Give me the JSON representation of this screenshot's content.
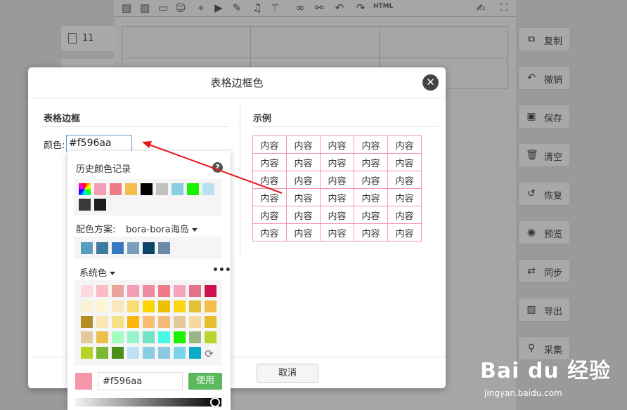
{
  "background": {
    "tab_label": "11",
    "toolbar_html_label": "HTML"
  },
  "side_buttons": [
    {
      "label": "复制",
      "icon": "copy-icon"
    },
    {
      "label": "撤销",
      "icon": "undo-icon"
    },
    {
      "label": "保存",
      "icon": "save-icon"
    },
    {
      "label": "清空",
      "icon": "trash-icon"
    },
    {
      "label": "恢复",
      "icon": "restore-icon"
    },
    {
      "label": "预览",
      "icon": "eye-icon"
    },
    {
      "label": "同步",
      "icon": "sync-icon"
    },
    {
      "label": "导出",
      "icon": "export-icon"
    },
    {
      "label": "采集",
      "icon": "search-icon"
    }
  ],
  "dialog": {
    "title": "表格边框色",
    "border_section_title": "表格边框",
    "color_label": "颜色:",
    "color_value": "#f596aa",
    "example_section_title": "示例",
    "example_cell_text": "内容",
    "cancel_label": "取消"
  },
  "picker": {
    "history_label": "历史颜色记录",
    "scheme_label": "配色方案:",
    "scheme_name": "bora-bora海岛",
    "system_label": "系统色",
    "hex_value": "#f596aa",
    "use_label": "使用",
    "current_color": "#f596aa",
    "history_colors": [
      "rainbow",
      "#f39cb4",
      "#ee7a86",
      "#f3bf4a",
      "#000000",
      "#c0c0c0",
      "#87cde4",
      "#19f201",
      "#b9e2ef",
      "#3a3a3a",
      "#1e1e1e"
    ],
    "scheme_colors": [
      "#5b9dc0",
      "#3f7aa0",
      "#3779c1",
      "#7b9dbd",
      "#0b4466",
      "#6a88a8"
    ],
    "system_colors": [
      [
        "#fbd9dd",
        "#fabdc8",
        "#eaa39e",
        "#f39cb4",
        "#ee8aa3",
        "#ee7a86",
        "#f5a2bb",
        "#e4708a",
        "#d0104c"
      ],
      [
        "#fbf2d5",
        "#fdf6d2",
        "#f9e8bd",
        "#fadc71",
        "#fdd500",
        "#e9c003",
        "#fed510",
        "#e4c037",
        "#f3bf4a"
      ],
      [
        "#b68d22",
        "#fbe4b6",
        "#f5e084",
        "#fcb60c",
        "#fcbc72",
        "#f4bb78",
        "#e2c89a",
        "#f6d99e",
        "#e6bd2a"
      ],
      [
        "#e1c99c",
        "#edbe4c",
        "#a1fdc0",
        "#95f4cc",
        "#6fe4c4",
        "#4af7e4",
        "#19f201",
        "#99b685",
        "#b9d42b"
      ],
      [
        "#b5d426",
        "#7db834",
        "#4c8e1b",
        "#bde1f0",
        "#89cee4",
        "#8dc8e1",
        "#7ed1eb",
        "#0babc7"
      ]
    ]
  }
}
